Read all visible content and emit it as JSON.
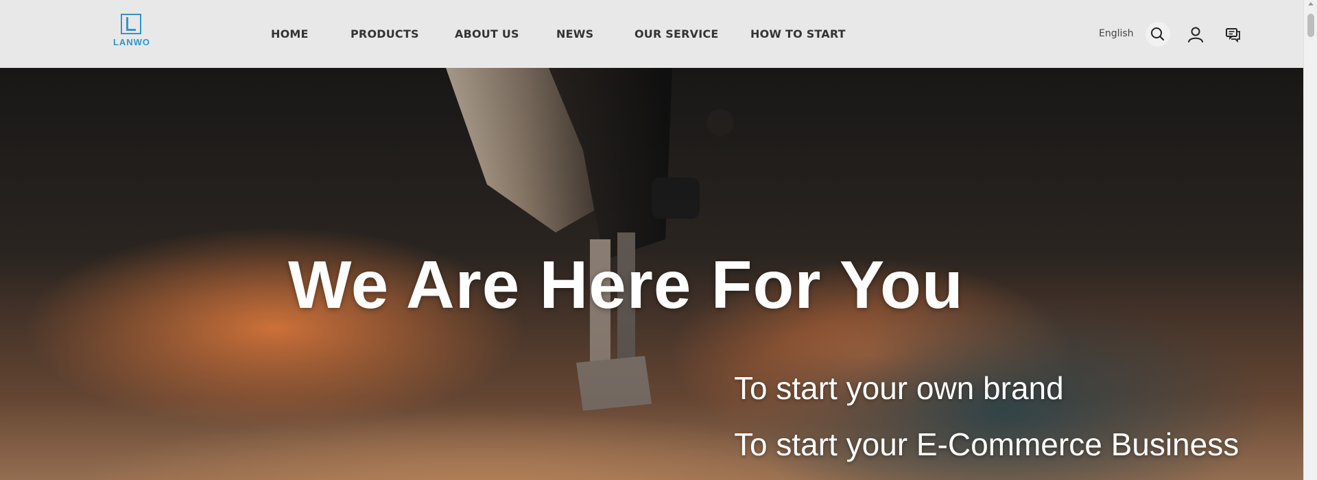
{
  "header": {
    "logo_text": "LANWO",
    "nav": [
      {
        "label": "HOME"
      },
      {
        "label": "PRODUCTS"
      },
      {
        "label": "ABOUT US"
      },
      {
        "label": "NEWS"
      },
      {
        "label": "OUR SERVICE"
      },
      {
        "label": "HOW TO START"
      }
    ],
    "language": "English",
    "icons": [
      "search-icon",
      "user-icon",
      "chat-icon"
    ]
  },
  "hero": {
    "title": "We Are Here For You",
    "lines": [
      "To start your own brand",
      "To start your E-Commerce Business"
    ]
  },
  "colors": {
    "brand": "#2f95d2",
    "header_bg": "#e8e8e8",
    "nav_text": "#333333",
    "hero_text": "#ffffff"
  }
}
